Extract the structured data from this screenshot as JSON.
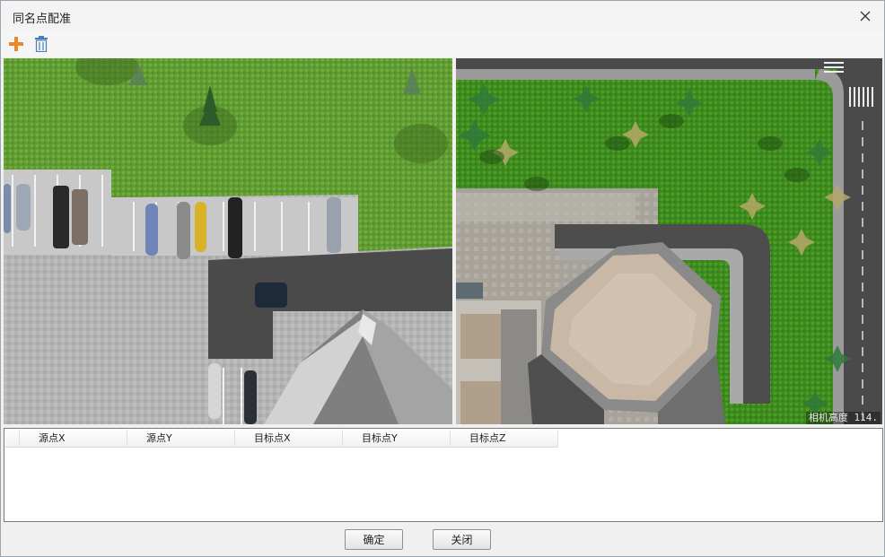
{
  "window": {
    "title": "同名点配准"
  },
  "icons": {
    "close": "close-icon",
    "add": "plus-icon",
    "delete": "trash-icon"
  },
  "colors": {
    "add_icon": "#e8892c",
    "delete_icon": "#4a7fb5"
  },
  "right_view": {
    "camera_label": "相机高度 114."
  },
  "table": {
    "columns": [
      "源点X",
      "源点Y",
      "目标点X",
      "目标点Y",
      "目标点Z"
    ],
    "rows": []
  },
  "footer": {
    "ok_label": "确定",
    "close_label": "关闭"
  }
}
